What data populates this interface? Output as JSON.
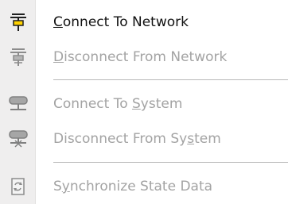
{
  "menu": {
    "items": [
      {
        "prefix": "",
        "accel": "C",
        "suffix": "onnect To Network",
        "icon": "network-connect-icon",
        "enabled": true
      },
      {
        "prefix": "",
        "accel": "D",
        "suffix": "isconnect From Network",
        "icon": "network-disconnect-icon",
        "enabled": false
      },
      {
        "prefix": "Connect To ",
        "accel": "S",
        "suffix": "ystem",
        "icon": "system-connect-icon",
        "enabled": false
      },
      {
        "prefix": "Disconnect From Sy",
        "accel": "s",
        "suffix": "tem",
        "icon": "system-disconnect-icon",
        "enabled": false
      },
      {
        "prefix": "S",
        "accel": "y",
        "suffix": "nchronize State Data",
        "icon": "synchronize-icon",
        "enabled": false
      }
    ]
  }
}
